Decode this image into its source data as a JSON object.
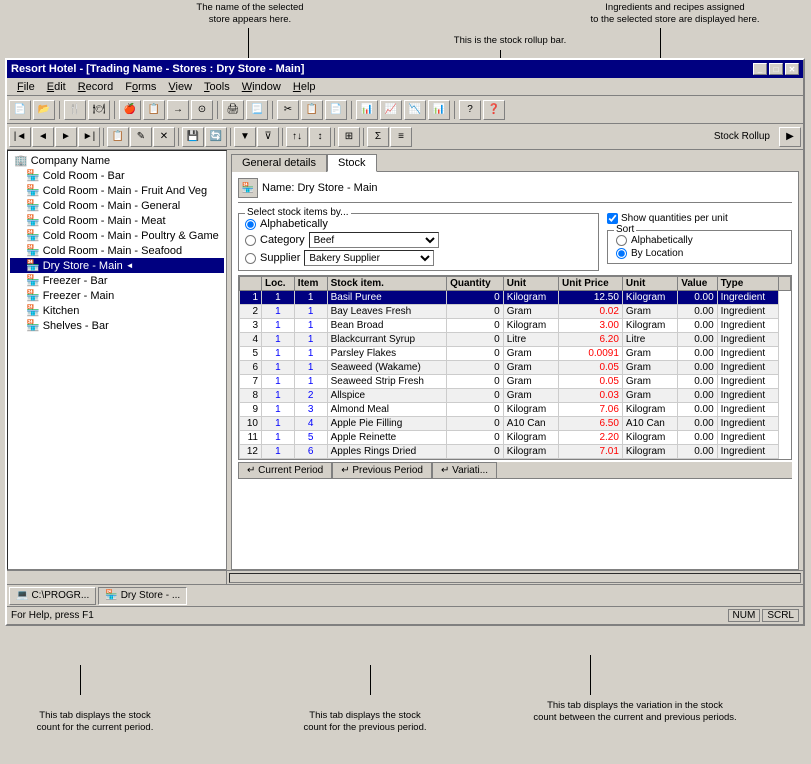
{
  "app": {
    "title": "Resort Hotel - [Trading Name - Stores : Dry Store - Main]",
    "title_inner": "Resort Hotel - [Trading Name - Stores : Dry Store - Main]"
  },
  "menu": {
    "items": [
      "File",
      "Edit",
      "Record",
      "Forms",
      "View",
      "Tools",
      "Window",
      "Help"
    ]
  },
  "annotations": {
    "top_left": "The name of the selected\nstore appears here.",
    "top_right": "Ingredients and recipes assigned\nto the selected store are displayed here.",
    "rollup_bar": "This is the stock rollup bar.",
    "bottom_left": "This tab displays the stock\ncount for the current period.",
    "bottom_mid": "This tab displays the stock\ncount for the previous period.",
    "bottom_right": "This tab displays the variation in the stock\ncount between the current and previous periods."
  },
  "sidebar": {
    "root_label": "Company Name",
    "items": [
      {
        "label": "Cold Room - Bar",
        "level": 1,
        "icon": "🏪"
      },
      {
        "label": "Cold Room - Main - Fruit And Veg",
        "level": 1,
        "icon": "🏪"
      },
      {
        "label": "Cold Room - Main - General",
        "level": 1,
        "icon": "🏪"
      },
      {
        "label": "Cold Room - Main - Meat",
        "level": 1,
        "icon": "🏪"
      },
      {
        "label": "Cold Room - Main - Poultry & Game",
        "level": 1,
        "icon": "🏪"
      },
      {
        "label": "Cold Room - Main - Seafood",
        "level": 1,
        "icon": "🏪"
      },
      {
        "label": "Dry Store - Main",
        "level": 1,
        "icon": "🏪",
        "selected": true
      },
      {
        "label": "Freezer - Bar",
        "level": 1,
        "icon": "🏪"
      },
      {
        "label": "Freezer - Main",
        "level": 1,
        "icon": "🏪"
      },
      {
        "label": "Kitchen",
        "level": 1,
        "icon": "🏪"
      },
      {
        "label": "Shelves - Bar",
        "level": 1,
        "icon": "🏪"
      }
    ]
  },
  "tabs": {
    "main_tabs": [
      "General details",
      "Stock"
    ],
    "active_tab": "Stock"
  },
  "store_panel": {
    "name_label": "Name:",
    "name_value": "Dry Store - Main",
    "select_by_label": "Select stock items by...",
    "radio_alpha": "Alphabetically",
    "radio_category": "Category",
    "radio_supplier": "Supplier",
    "category_value": "Beef",
    "supplier_value": "Bakery Supplier",
    "show_qty_label": "Show quantities per unit",
    "sort_label": "Sort",
    "sort_alpha": "Alphabetically",
    "sort_byloc": "By Location"
  },
  "table": {
    "headers": [
      "Loc.",
      "Item",
      "Stock item.",
      "Quantity",
      "Unit",
      "Unit Price",
      "Unit",
      "Value",
      "Type"
    ],
    "rows": [
      {
        "num": 1,
        "loc": "1",
        "item": "1",
        "stock": "Basil Puree",
        "qty": "0",
        "unit": "Kilogram",
        "uprice": "12.50",
        "uunit": "Kilogram",
        "value": "0.00",
        "type": "Ingredient",
        "selected": true
      },
      {
        "num": 2,
        "loc": "1",
        "item": "1",
        "stock": "Bay Leaves Fresh",
        "qty": "0",
        "unit": "Gram",
        "uprice": "0.02",
        "uunit": "Gram",
        "value": "0.00",
        "type": "Ingredient"
      },
      {
        "num": 3,
        "loc": "1",
        "item": "1",
        "stock": "Bean Broad",
        "qty": "0",
        "unit": "Kilogram",
        "uprice": "3.00",
        "uunit": "Kilogram",
        "value": "0.00",
        "type": "Ingredient"
      },
      {
        "num": 4,
        "loc": "1",
        "item": "1",
        "stock": "Blackcurrant Syrup",
        "qty": "0",
        "unit": "Litre",
        "uprice": "6.20",
        "uunit": "Litre",
        "value": "0.00",
        "type": "Ingredient"
      },
      {
        "num": 5,
        "loc": "1",
        "item": "1",
        "stock": "Parsley Flakes",
        "qty": "0",
        "unit": "Gram",
        "uprice": "0.0091",
        "uunit": "Gram",
        "value": "0.00",
        "type": "Ingredient"
      },
      {
        "num": 6,
        "loc": "1",
        "item": "1",
        "stock": "Seaweed (Wakame)",
        "qty": "0",
        "unit": "Gram",
        "uprice": "0.05",
        "uunit": "Gram",
        "value": "0.00",
        "type": "Ingredient"
      },
      {
        "num": 7,
        "loc": "1",
        "item": "1",
        "stock": "Seaweed Strip Fresh",
        "qty": "0",
        "unit": "Gram",
        "uprice": "0.05",
        "uunit": "Gram",
        "value": "0.00",
        "type": "Ingredient"
      },
      {
        "num": 8,
        "loc": "1",
        "item": "2",
        "stock": "Allspice",
        "qty": "0",
        "unit": "Gram",
        "uprice": "0.03",
        "uunit": "Gram",
        "value": "0.00",
        "type": "Ingredient"
      },
      {
        "num": 9,
        "loc": "1",
        "item": "3",
        "stock": "Almond Meal",
        "qty": "0",
        "unit": "Kilogram",
        "uprice": "7.06",
        "uunit": "Kilogram",
        "value": "0.00",
        "type": "Ingredient"
      },
      {
        "num": 10,
        "loc": "1",
        "item": "4",
        "stock": "Apple Pie Filling",
        "qty": "0",
        "unit": "A10 Can",
        "uprice": "6.50",
        "uunit": "A10 Can",
        "value": "0.00",
        "type": "Ingredient"
      },
      {
        "num": 11,
        "loc": "1",
        "item": "5",
        "stock": "Apple Reinette",
        "qty": "0",
        "unit": "Kilogram",
        "uprice": "2.20",
        "uunit": "Kilogram",
        "value": "0.00",
        "type": "Ingredient"
      },
      {
        "num": 12,
        "loc": "1",
        "item": "6",
        "stock": "Apples Rings Dried",
        "qty": "0",
        "unit": "Kilogram",
        "uprice": "7.01",
        "uunit": "Kilogram",
        "value": "0.00",
        "type": "Ingredient"
      }
    ]
  },
  "bottom_tabs": [
    "Current Period",
    "Previous Period",
    "Variati..."
  ],
  "taskbar": {
    "items": [
      "C:\\PROGR...",
      "Dry Store - ..."
    ]
  },
  "status": {
    "help": "For Help, press F1",
    "indicators": [
      "NUM",
      "SCRL"
    ]
  }
}
